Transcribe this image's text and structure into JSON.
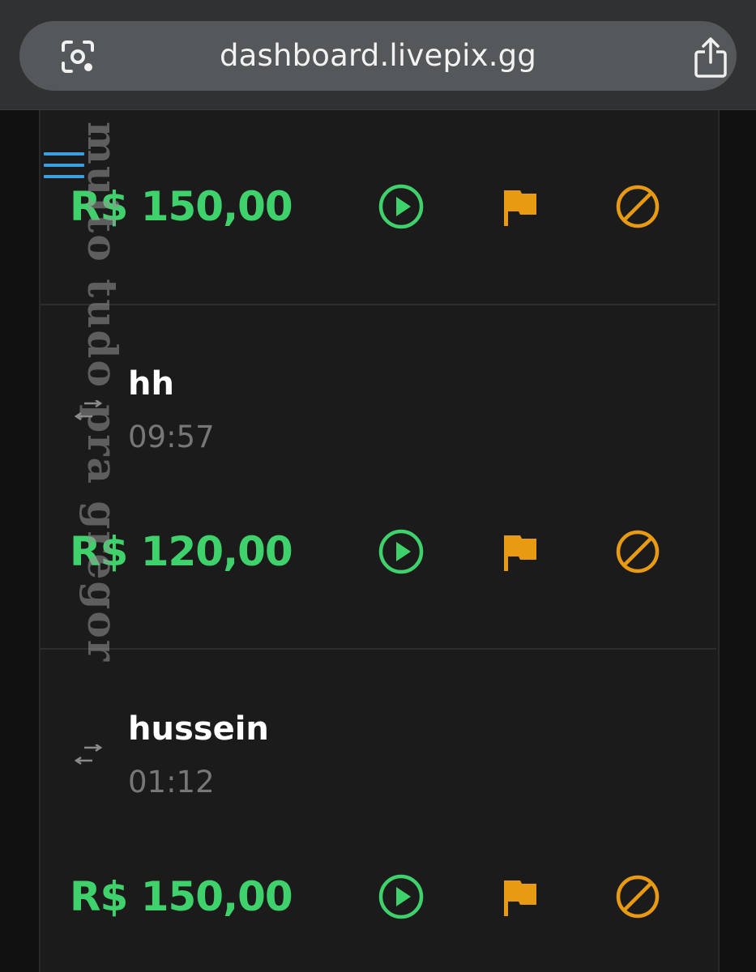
{
  "browser": {
    "url": "dashboard.livepix.gg"
  },
  "colors": {
    "amount": "#3fd16b",
    "play": "#3fd16b",
    "flag": "#e89a12",
    "block": "#e89a12",
    "menu": "#3ba0e0"
  },
  "watermark": {
    "text": "muito tudo pra gregor"
  },
  "donations": [
    {
      "amount": "R$ 150,00"
    },
    {
      "name": "hh",
      "time": "09:57",
      "amount": "R$ 120,00"
    },
    {
      "name": "hussein",
      "time": "01:12",
      "amount": "R$ 150,00"
    }
  ],
  "icons": {
    "menu": "hamburger-menu-icon",
    "lens": "google-lens-icon",
    "share": "share-icon",
    "play": "play-circle-icon",
    "flag": "flag-icon",
    "block": "block-icon",
    "transfer": "transfer-arrows-icon"
  }
}
